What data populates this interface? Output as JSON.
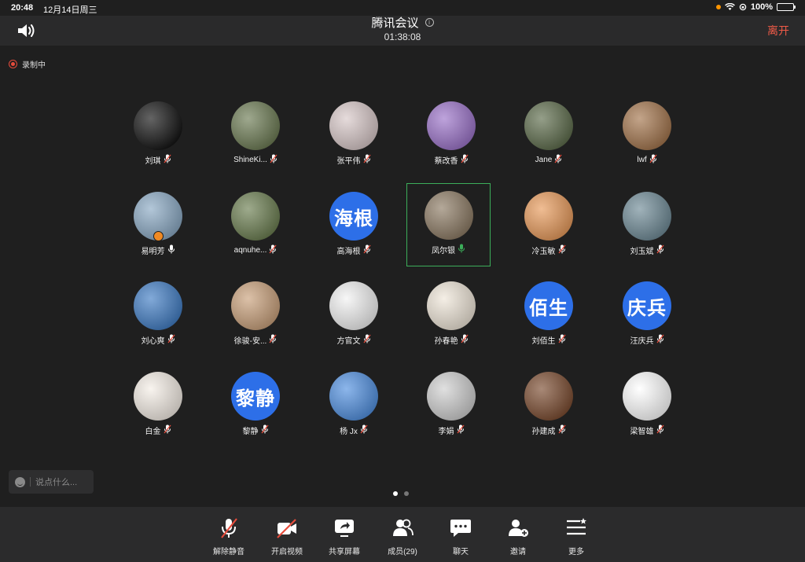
{
  "status_bar": {
    "time": "20:48",
    "date": "12月14日周三",
    "battery": "100%"
  },
  "header": {
    "title": "腾讯会议",
    "timer": "01:38:08",
    "leave_label": "离开"
  },
  "recording": {
    "label": "录制中"
  },
  "participants": [
    {
      "name": "刘琪",
      "mic": "muted",
      "avatar": "formula-photo",
      "avatar_color": "#111111"
    },
    {
      "name": "ShineKi...",
      "mic": "muted",
      "avatar": "forest-photo",
      "avatar_color": "#6b7a52"
    },
    {
      "name": "张平伟",
      "mic": "muted",
      "avatar": "family-photo",
      "avatar_color": "#d8c8c8"
    },
    {
      "name": "蔡改香",
      "mic": "muted",
      "avatar": "purple-rose-photo",
      "avatar_color": "#9b72c9"
    },
    {
      "name": "Jane",
      "mic": "muted",
      "avatar": "white-flower-photo",
      "avatar_color": "#5c6b4a"
    },
    {
      "name": "lwf",
      "mic": "muted",
      "avatar": "books-photo",
      "avatar_color": "#a3744b"
    },
    {
      "name": "易明芳",
      "mic": "on",
      "avatar": "waterfall-photo",
      "avatar_color": "#8aa9c4",
      "badge": true
    },
    {
      "name": "aqnuhe...",
      "mic": "muted",
      "avatar": "people-garden-photo",
      "avatar_color": "#6a7d4f"
    },
    {
      "name": "高海根",
      "mic": "muted",
      "avatar_text": "海根",
      "avatar_color": "#2d6fe8"
    },
    {
      "name": "凤尔银",
      "mic": "speaking",
      "avatar": "field-photo",
      "avatar_color": "#8c7a63",
      "active": true
    },
    {
      "name": "冷玉敏",
      "mic": "muted",
      "avatar": "sunset-photo",
      "avatar_color": "#e89a5a"
    },
    {
      "name": "刘玉斌",
      "mic": "muted",
      "avatar": "coast-photo",
      "avatar_color": "#6e8a96"
    },
    {
      "name": "刘心爽",
      "mic": "muted",
      "avatar": "cartoon-hat-photo",
      "avatar_color": "#3f7cc4"
    },
    {
      "name": "徐骏-安...",
      "mic": "muted",
      "avatar": "mother-baby-photo",
      "avatar_color": "#c9a07a"
    },
    {
      "name": "方官文",
      "mic": "muted",
      "avatar": "school-seal",
      "avatar_color": "#f2f2f2"
    },
    {
      "name": "孙春艳",
      "mic": "muted",
      "avatar": "anime-girl-photo",
      "avatar_color": "#efe6d8"
    },
    {
      "name": "刘佰生",
      "mic": "muted",
      "avatar_text": "佰生",
      "avatar_color": "#2d6fe8"
    },
    {
      "name": "汪庆兵",
      "mic": "muted",
      "avatar_text": "庆兵",
      "avatar_color": "#2d6fe8"
    },
    {
      "name": "白金",
      "mic": "muted",
      "avatar": "rabbit-cartoon",
      "avatar_color": "#f5eee6"
    },
    {
      "name": "黎静",
      "mic": "muted",
      "avatar_text": "黎静",
      "avatar_color": "#2d6fe8"
    },
    {
      "name": "杨 Jx",
      "mic": "muted",
      "avatar": "dove-photo",
      "avatar_color": "#4f8fe0"
    },
    {
      "name": "李娟",
      "mic": "muted",
      "avatar": "doodle-art",
      "avatar_color": "#cfcfcf"
    },
    {
      "name": "孙建成",
      "mic": "muted",
      "avatar": "anime-warrior",
      "avatar_color": "#7a4a2e"
    },
    {
      "name": "梁智雄",
      "mic": "muted",
      "avatar": "panda-face",
      "avatar_color": "#ffffff"
    }
  ],
  "chat": {
    "placeholder": "说点什么..."
  },
  "pager": {
    "current": 1,
    "total": 2
  },
  "toolbar": [
    {
      "id": "unmute",
      "label": "解除静音",
      "icon": "mic-off-icon"
    },
    {
      "id": "video",
      "label": "开启视频",
      "icon": "camera-off-icon"
    },
    {
      "id": "share",
      "label": "共享屏幕",
      "icon": "share-screen-icon"
    },
    {
      "id": "members",
      "label": "成员(29)",
      "icon": "members-icon"
    },
    {
      "id": "chat",
      "label": "聊天",
      "icon": "chat-icon"
    },
    {
      "id": "invite",
      "label": "邀请",
      "icon": "invite-icon"
    },
    {
      "id": "more",
      "label": "更多",
      "icon": "more-icon"
    }
  ],
  "colors": {
    "accent_red": "#f05b48",
    "active_green": "#3cae5a",
    "avatar_blue": "#2d6fe8"
  }
}
